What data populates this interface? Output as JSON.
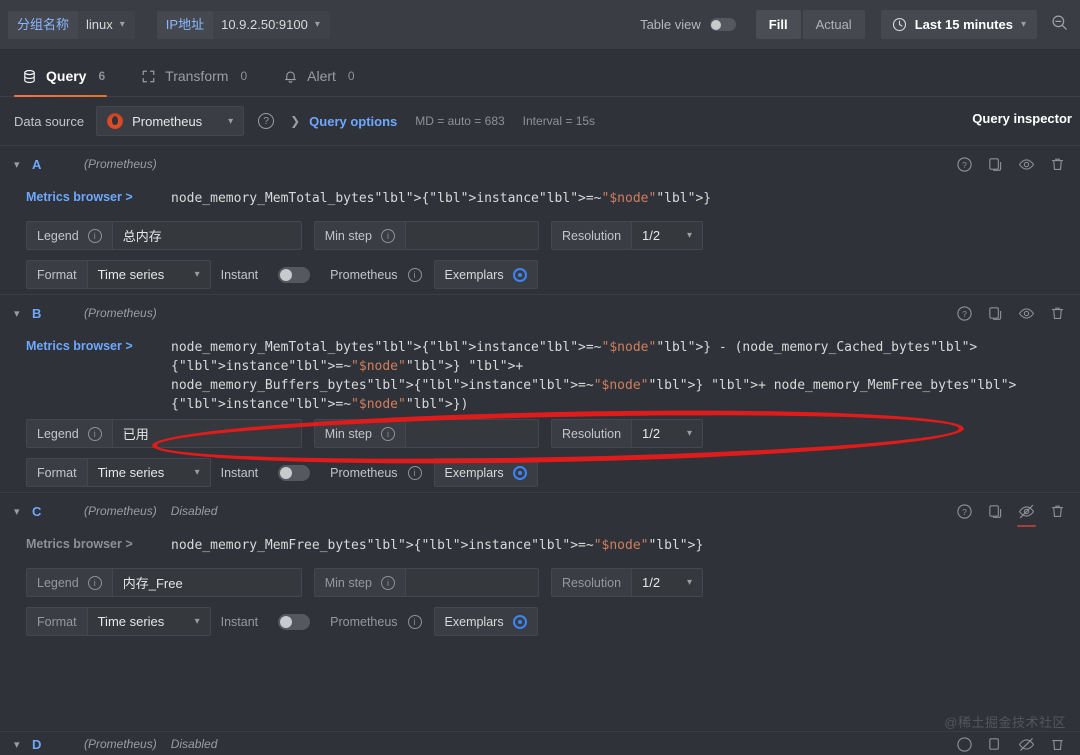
{
  "topbar": {
    "variables": [
      {
        "label": "分组名称",
        "value": "linux",
        "icon": "chevron-down-icon"
      },
      {
        "label": "IP地址",
        "value": "10.9.2.50:9100",
        "icon": "chevron-down-icon"
      }
    ],
    "table_view_label": "Table view",
    "table_view_on": false,
    "fill_label": "Fill",
    "actual_label": "Actual",
    "time_range": "Last 15 minutes",
    "clock_icon": "clock-icon",
    "zoom_out_icon": "zoom-out-icon"
  },
  "tabs": [
    {
      "label": "Query",
      "count": "6",
      "icon": "database-icon",
      "active": true
    },
    {
      "label": "Transform",
      "count": "0",
      "icon": "transform-icon",
      "active": false
    },
    {
      "label": "Alert",
      "count": "0",
      "icon": "bell-icon",
      "active": false
    }
  ],
  "datasource_row": {
    "label": "Data source",
    "name": "Prometheus",
    "icon": "prometheus-flame-icon",
    "help_icon": "help-circle-icon",
    "query_options_label": "Query options",
    "max_data_points": "MD = auto = 683",
    "interval": "Interval = 15s",
    "query_inspector_label": "Query inspector"
  },
  "field_labels": {
    "legend": "Legend",
    "min_step": "Min step",
    "resolution": "Resolution",
    "format": "Format",
    "instant": "Instant",
    "exemplars": "Exemplars",
    "metrics_browser": "Metrics browser",
    "metrics_browser_caret": ">",
    "datasource_name": "Prometheus"
  },
  "queries": [
    {
      "id": "A",
      "datasource": "(Prometheus)",
      "disabled_label": "",
      "expression": "node_memory_MemTotal_bytes{instance=~\"$node\"}",
      "legend": "总内存",
      "min_step": "",
      "resolution": "1/2",
      "format": "Time series",
      "instant_on": false,
      "exemplars_on": true,
      "visible": true
    },
    {
      "id": "B",
      "datasource": "(Prometheus)",
      "disabled_label": "",
      "expression": "node_memory_MemTotal_bytes{instance=~\"$node\"} - (node_memory_Cached_bytes{instance=~\"$node\"} +\nnode_memory_Buffers_bytes{instance=~\"$node\"} + node_memory_MemFree_bytes{instance=~\"$node\"})",
      "legend": "已用",
      "min_step": "",
      "resolution": "1/2",
      "format": "Time series",
      "instant_on": false,
      "exemplars_on": true,
      "visible": true
    },
    {
      "id": "C",
      "datasource": "(Prometheus)",
      "disabled_label": "Disabled",
      "expression": "node_memory_MemFree_bytes{instance=~\"$node\"}",
      "legend": "内存_Free",
      "min_step": "",
      "resolution": "1/2",
      "format": "Time series",
      "instant_on": false,
      "exemplars_on": true,
      "visible": false
    },
    {
      "id": "D",
      "datasource": "(Prometheus)",
      "disabled_label": "Disabled",
      "expression": "",
      "legend": "",
      "min_step": "",
      "resolution": "",
      "format": "",
      "instant_on": false,
      "exemplars_on": false,
      "visible": false
    }
  ],
  "annotation": {
    "shape": "red-ellipse",
    "color": "#e01b1b",
    "target": "query-b-expression"
  },
  "watermark": "@稀土掘金技术社区"
}
